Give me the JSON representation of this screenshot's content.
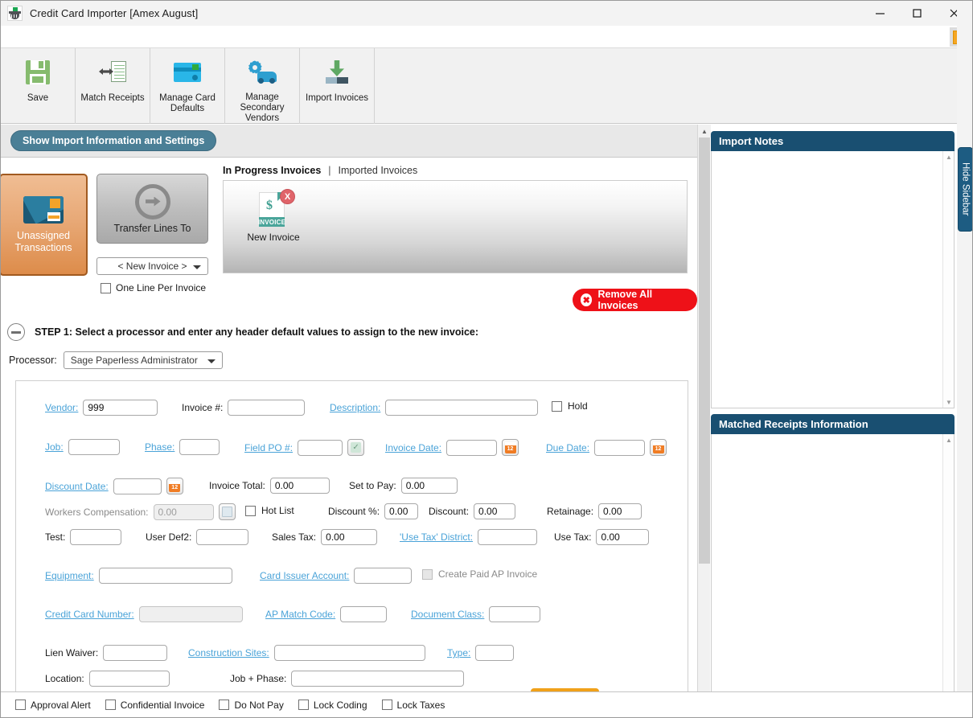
{
  "window": {
    "title": "Credit Card Importer [Amex August]",
    "app_icon": "camera-scanner-icon",
    "minimize": "minimize-icon",
    "maximize": "maximize-icon",
    "close": "close-icon"
  },
  "quickstrip": {
    "orange_button_icon": "orange-square-icon"
  },
  "ribbon": {
    "items": [
      {
        "label": "Save",
        "icon": "floppy-disk-icon"
      },
      {
        "label": "Match Receipts",
        "icon": "match-receipts-icon"
      },
      {
        "label": "Manage Card Defaults",
        "icon": "credit-card-icon"
      },
      {
        "label": "Manage Secondary Vendors",
        "icon": "gear-truck-icon"
      },
      {
        "label": "Import Invoices",
        "icon": "download-arrow-icon"
      }
    ]
  },
  "import_bar": {
    "show_settings_label": "Show Import Information and Settings"
  },
  "left": {
    "unassigned_card": {
      "label_line1": "Unassigned",
      "label_line2": "Transactions",
      "icon": "credit-card-icon"
    },
    "transfer_button": {
      "label": "Transfer Lines To",
      "icon": "arrow-right-circle-icon"
    },
    "new_invoice_select": {
      "value": "< New Invoice >",
      "caret": "chevron-down-icon"
    },
    "one_line_per_invoice": {
      "label": "One Line Per Invoice",
      "checked": false
    },
    "tabs": {
      "active": "In Progress Invoices",
      "separator": "|",
      "inactive": "Imported Invoices"
    },
    "invoice_tiles": [
      {
        "label": "New Invoice",
        "icon": "invoice-document-icon",
        "badge": "X",
        "tag": "INVOICE",
        "symbol": "$"
      }
    ],
    "remove_all_button": {
      "label": "Remove All Invoices",
      "icon": "close-circle-icon"
    },
    "step1": {
      "toggle_icon": "collapse-minus-icon",
      "text": "STEP 1: Select a processor and enter any header default values to assign to the new invoice:"
    },
    "processor": {
      "label": "Processor:",
      "value": "Sage Paperless Administrator",
      "caret": "chevron-down-icon"
    }
  },
  "form": {
    "vendor": {
      "label": "Vendor:",
      "value": "999"
    },
    "invoice_number": {
      "label": "Invoice #:",
      "value": ""
    },
    "description": {
      "label": "Description:",
      "value": ""
    },
    "hold": {
      "label": "Hold",
      "checked": false
    },
    "job": {
      "label": "Job:",
      "value": ""
    },
    "phase": {
      "label": "Phase:",
      "value": ""
    },
    "field_po": {
      "label": "Field PO #:",
      "value": "",
      "button_icon": "checkmark-icon"
    },
    "invoice_date": {
      "label": "Invoice Date:",
      "value": "",
      "button_icon": "calendar-icon",
      "calendar_day": "12"
    },
    "due_date": {
      "label": "Due Date:",
      "value": "",
      "button_icon": "calendar-icon",
      "calendar_day": "12"
    },
    "discount_date": {
      "label": "Discount Date:",
      "value": "",
      "button_icon": "calendar-icon",
      "calendar_day": "12"
    },
    "invoice_total": {
      "label": "Invoice Total:",
      "value": "0.00"
    },
    "set_to_pay": {
      "label": "Set to Pay:",
      "value": "0.00"
    },
    "workers_comp": {
      "label": "Workers Compensation:",
      "value": "0.00",
      "button_icon": "calculator-icon"
    },
    "hot_list": {
      "label": "Hot List",
      "checked": false
    },
    "discount_pct": {
      "label": "Discount %:",
      "value": "0.00"
    },
    "discount": {
      "label": "Discount:",
      "value": "0.00"
    },
    "retainage": {
      "label": "Retainage:",
      "value": "0.00"
    },
    "test": {
      "label": "Test:",
      "value": ""
    },
    "user_def2": {
      "label": "User Def2:",
      "value": ""
    },
    "sales_tax": {
      "label": "Sales Tax:",
      "value": "0.00"
    },
    "use_tax_district": {
      "label": "'Use Tax' District:",
      "value": ""
    },
    "use_tax": {
      "label": "Use Tax:",
      "value": "0.00"
    },
    "equipment": {
      "label": "Equipment:",
      "value": ""
    },
    "card_issuer_account": {
      "label": "Card Issuer Account:",
      "value": ""
    },
    "create_paid_ap": {
      "label": "Create Paid AP Invoice",
      "checked": false
    },
    "credit_card_number": {
      "label": "Credit Card Number:",
      "value": ""
    },
    "ap_match_code": {
      "label": "AP Match Code:",
      "value": ""
    },
    "document_class": {
      "label": "Document Class:",
      "value": ""
    },
    "lien_waiver": {
      "label": "Lien Waiver:",
      "value": ""
    },
    "construction_sites": {
      "label": "Construction Sites:",
      "value": ""
    },
    "type": {
      "label": "Type:",
      "value": ""
    },
    "location": {
      "label": "Location:",
      "value": ""
    },
    "job_phase": {
      "label": "Job + Phase:",
      "value": ""
    }
  },
  "bottom_bar": {
    "checkboxes": [
      {
        "label": "Approval Alert",
        "checked": false
      },
      {
        "label": "Confidential Invoice",
        "checked": false
      },
      {
        "label": "Do Not Pay",
        "checked": false
      },
      {
        "label": "Lock Coding",
        "checked": false
      },
      {
        "label": "Lock Taxes",
        "checked": false
      }
    ]
  },
  "sidebar": {
    "import_notes": {
      "title": "Import Notes",
      "content": ""
    },
    "matched_receipts": {
      "title": "Matched Receipts Information",
      "content": ""
    },
    "hide_tab": {
      "label": "Hide Sidebar"
    }
  }
}
